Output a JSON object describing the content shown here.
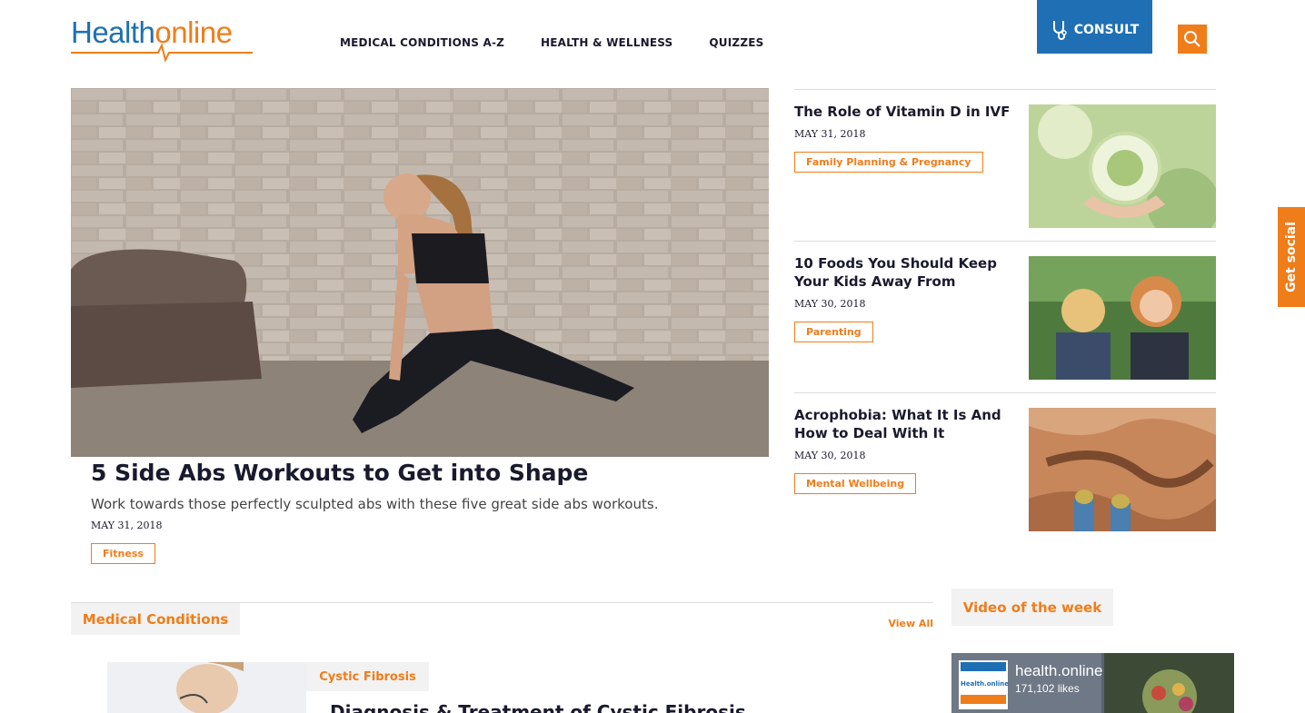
{
  "header": {
    "logo": {
      "part1": "Health",
      "part2": "online"
    },
    "nav": [
      "MEDICAL CONDITIONS A-Z",
      "HEALTH & WELLNESS",
      "QUIZZES"
    ],
    "consult_label": "CONSULT",
    "icons": {
      "consult": "stethoscope-icon",
      "search": "search-icon"
    }
  },
  "featured": {
    "title": "5 Side Abs Workouts to Get into Shape",
    "description": "Work towards those perfectly sculpted abs with these five great side abs workouts.",
    "date": "MAY 31, 2018",
    "tag": "Fitness"
  },
  "side_articles": [
    {
      "title": "The Role of Vitamin D in IVF",
      "date": "MAY 31, 2018",
      "tag": "Family Planning & Pregnancy"
    },
    {
      "title": "10 Foods You Should Keep Your Kids Away From",
      "date": "MAY 30, 2018",
      "tag": "Parenting"
    },
    {
      "title": "Acrophobia: What It Is And How to Deal With It",
      "date": "MAY 30, 2018",
      "tag": "Mental Wellbeing"
    }
  ],
  "get_social": "Get social",
  "medical_conditions": {
    "heading": "Medical Conditions",
    "view_all": "View All",
    "category": "Cystic Fibrosis",
    "article_title": "Diagnosis & Treatment of Cystic Fibrosis"
  },
  "video_of_week": {
    "heading": "Video of the week",
    "page_name": "health.online",
    "likes": "171,102 likes",
    "logo_text": "Health.online"
  },
  "colors": {
    "brand_blue": "#1f6fb4",
    "brand_orange": "#ef7d1a"
  }
}
